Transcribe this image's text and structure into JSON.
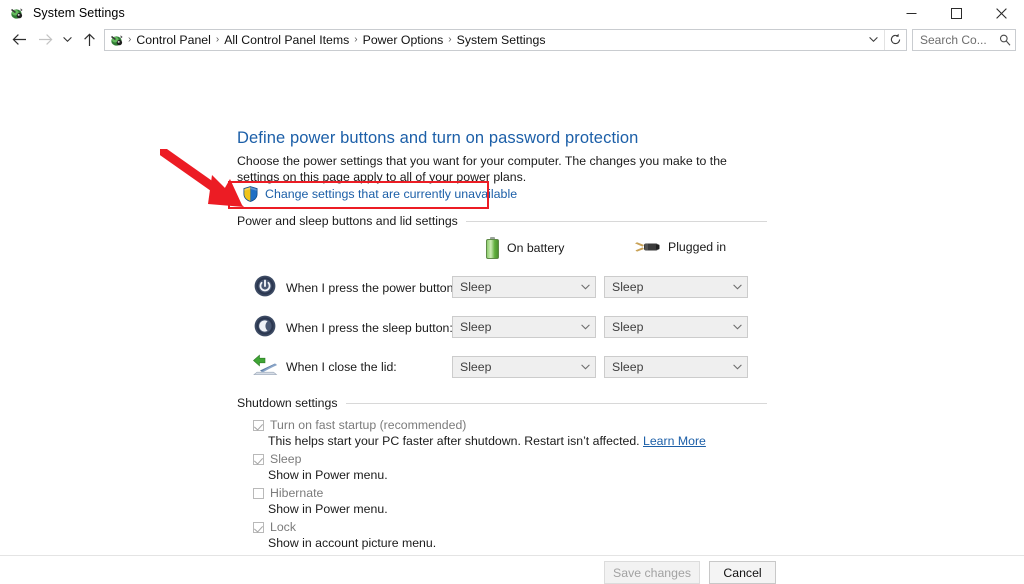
{
  "window": {
    "title": "System Settings",
    "icon": "control-panel-icon",
    "controls": {
      "minimize": "minimize-icon",
      "maximize": "maximize-icon",
      "close": "close-icon"
    }
  },
  "nav": {
    "back": "back-arrow-icon",
    "forward": "forward-arrow-icon",
    "recent": "chevron-down-icon",
    "up": "up-arrow-icon",
    "address_icon": "control-panel-icon",
    "breadcrumbs": [
      "Control Panel",
      "All Control Panel Items",
      "Power Options",
      "System Settings"
    ],
    "separator": "›",
    "dropdown": "chevron-down-icon",
    "refresh": "refresh-icon"
  },
  "search": {
    "placeholder": "Search Co...",
    "icon": "search-icon"
  },
  "main": {
    "heading": "Define power buttons and turn on password protection",
    "description": "Choose the power settings that you want for your computer. The changes you make to the settings on this page apply to all of your power plans.",
    "uac_link": "Change settings that are currently unavailable",
    "uac_icon": "shield-icon",
    "highlight_color": "#ec1c24",
    "link_color": "#1c5fa8"
  },
  "power_section": {
    "title": "Power and sleep buttons and lid settings",
    "columns": [
      {
        "label": "On battery",
        "icon": "battery-icon"
      },
      {
        "label": "Plugged in",
        "icon": "power-plug-icon"
      }
    ],
    "rows": [
      {
        "icon": "power-button-icon",
        "label": "When I press the power button:",
        "battery": "Sleep",
        "plugged": "Sleep"
      },
      {
        "icon": "sleep-moon-icon",
        "label": "When I press the sleep button:",
        "battery": "Sleep",
        "plugged": "Sleep"
      },
      {
        "icon": "laptop-lid-icon",
        "label": "When I close the lid:",
        "battery": "Sleep",
        "plugged": "Sleep"
      }
    ]
  },
  "shutdown_section": {
    "title": "Shutdown settings",
    "items": [
      {
        "label": "Turn on fast startup (recommended)",
        "checked": true,
        "sub_prefix": "This helps start your PC faster after shutdown. Restart isn’t affected. ",
        "sub_link": "Learn More"
      },
      {
        "label": "Sleep",
        "checked": true,
        "sub_prefix": "Show in Power menu.",
        "sub_link": ""
      },
      {
        "label": "Hibernate",
        "checked": false,
        "sub_prefix": "Show in Power menu.",
        "sub_link": ""
      },
      {
        "label": "Lock",
        "checked": true,
        "sub_prefix": "Show in account picture menu.",
        "sub_link": ""
      }
    ]
  },
  "footer": {
    "save_label": "Save changes",
    "save_disabled": true,
    "cancel_label": "Cancel"
  }
}
